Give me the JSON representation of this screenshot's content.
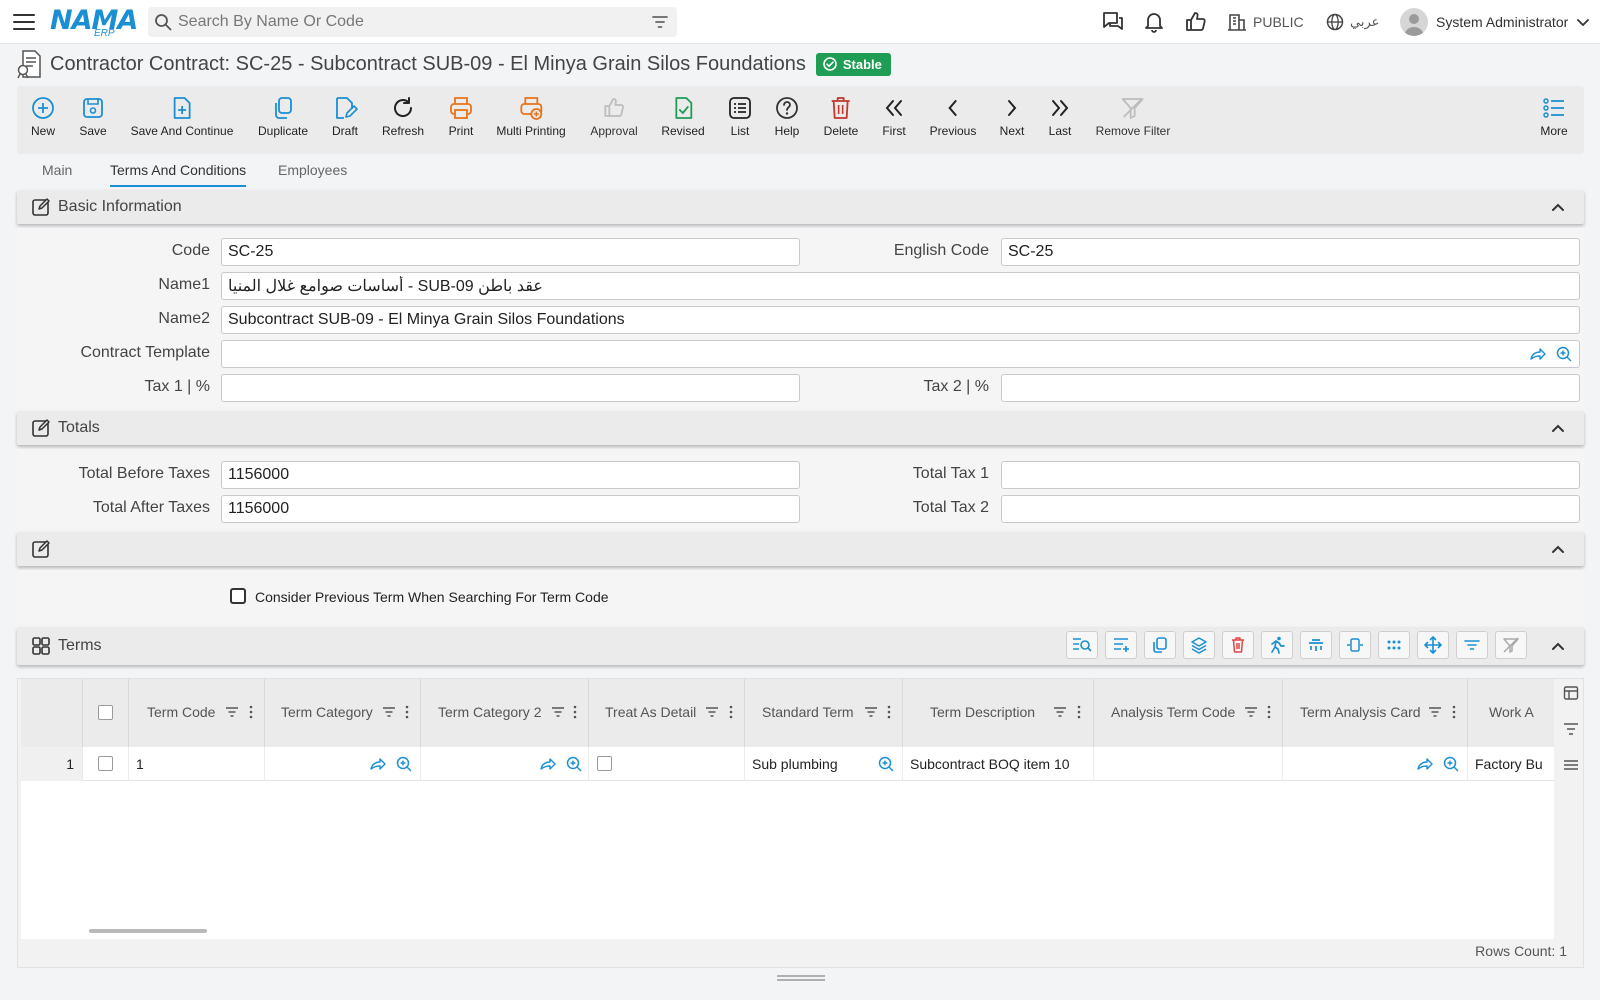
{
  "colors": {
    "accent": "#1a8fd4",
    "stable": "#1f9d55",
    "delete": "#c0392b",
    "print": "#e8731a"
  },
  "header": {
    "logo_main": "NAMA",
    "logo_sub": "ERP",
    "search_placeholder": "Search By Name Or Code",
    "public_label": "PUBLIC",
    "lang_label": "عربي",
    "user_name": "System Administrator"
  },
  "page": {
    "title": "Contractor Contract: SC-25 - Subcontract SUB-09 - El Minya Grain Silos Foundations",
    "status": "Stable"
  },
  "toolbar": [
    {
      "label": "New",
      "icon": "plus-circle-icon"
    },
    {
      "label": "Save",
      "icon": "save-icon"
    },
    {
      "label": "Save And Continue",
      "icon": "file-plus-icon"
    },
    {
      "label": "Duplicate",
      "icon": "copy-icon"
    },
    {
      "label": "Draft",
      "icon": "draft-icon"
    },
    {
      "label": "Refresh",
      "icon": "refresh-icon"
    },
    {
      "label": "Print",
      "icon": "print-icon"
    },
    {
      "label": "Multi Printing",
      "icon": "multi-print-icon"
    },
    {
      "label": "Approval",
      "icon": "thumbs-up-icon"
    },
    {
      "label": "Revised",
      "icon": "file-check-icon"
    },
    {
      "label": "List",
      "icon": "list-icon"
    },
    {
      "label": "Help",
      "icon": "help-icon"
    },
    {
      "label": "Delete",
      "icon": "trash-icon"
    },
    {
      "label": "First",
      "icon": "double-chevron-left-icon"
    },
    {
      "label": "Previous",
      "icon": "chevron-left-icon"
    },
    {
      "label": "Next",
      "icon": "chevron-right-icon"
    },
    {
      "label": "Last",
      "icon": "double-chevron-right-icon"
    },
    {
      "label": "Remove Filter",
      "icon": "filter-off-icon"
    },
    {
      "label": "More",
      "icon": "more-list-icon"
    }
  ],
  "tabs": [
    {
      "label": "Main"
    },
    {
      "label": "Terms And Conditions"
    },
    {
      "label": "Employees"
    }
  ],
  "basic": {
    "title": "Basic Information",
    "code_label": "Code",
    "code_value": "SC-25",
    "english_code_label": "English Code",
    "english_code_value": "SC-25",
    "name1_label": "Name1",
    "name1_value": "عقد باطن SUB-09 - أساسات صوامع غلال المنيا",
    "name2_label": "Name2",
    "name2_value": "Subcontract SUB-09 - El Minya Grain Silos Foundations",
    "template_label": "Contract Template",
    "template_value": "",
    "tax1_label": "Tax 1 | %",
    "tax1_value": "",
    "tax2_label": "Tax 2 | %",
    "tax2_value": ""
  },
  "totals": {
    "title": "Totals",
    "before_label": "Total Before Taxes",
    "before_value": "1156000",
    "after_label": "Total After Taxes",
    "after_value": "1156000",
    "tax1_label": "Total Tax 1",
    "tax1_value": "",
    "tax2_label": "Total Tax 2",
    "tax2_value": ""
  },
  "options": {
    "consider_label": "Consider Previous Term When Searching For Term Code"
  },
  "terms": {
    "title": "Terms",
    "columns": [
      "Term Code",
      "Term Category",
      "Term Category 2",
      "Treat As Detail",
      "Standard Term",
      "Term Description",
      "Analysis Term Code",
      "Term Analysis Card",
      "Work A"
    ],
    "rows": [
      {
        "num": "1",
        "term_code": "1",
        "standard_term": "Sub plumbing",
        "description": "Subcontract BOQ item 10",
        "work": "Factory Bu"
      }
    ],
    "rows_count": "Rows Count: 1"
  }
}
